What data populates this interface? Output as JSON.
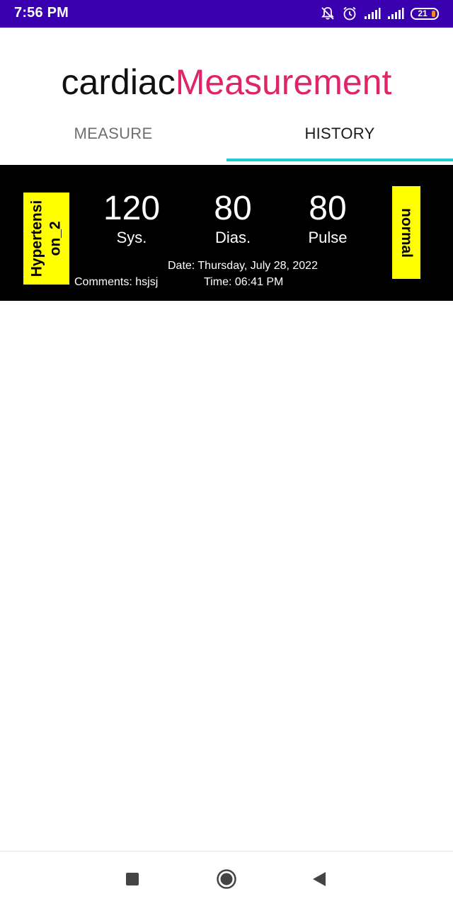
{
  "status_bar": {
    "time": "7:56 PM",
    "battery_level": "21",
    "background_color": "#3a00b0",
    "icons": [
      "notifications-off-icon",
      "alarm-icon",
      "signal-icon",
      "signal-icon",
      "battery-icon"
    ]
  },
  "app": {
    "title_part1": "cardiac",
    "title_part2": "Measurement",
    "accent_color": "#e0246a"
  },
  "tabs": [
    {
      "label": "MEASURE",
      "active": false
    },
    {
      "label": "HISTORY",
      "active": true
    }
  ],
  "tab_indicator_color": "#1ecbd0",
  "history": [
    {
      "category": "Hypertension_2",
      "category_lines": [
        "Hypertensi",
        "on_2"
      ],
      "status": "normal",
      "systolic": "120",
      "systolic_label": "Sys.",
      "diastolic": "80",
      "diastolic_label": "Dias.",
      "pulse": "80",
      "pulse_label": "Pulse",
      "date": "Date: Thursday, July 28, 2022",
      "comments": "Comments: hsjsj",
      "time": "Time: 06:41 PM",
      "badge_color": "#ffff00"
    }
  ],
  "nav_bar": {
    "icons": [
      "recents-icon",
      "home-icon",
      "back-icon"
    ]
  }
}
